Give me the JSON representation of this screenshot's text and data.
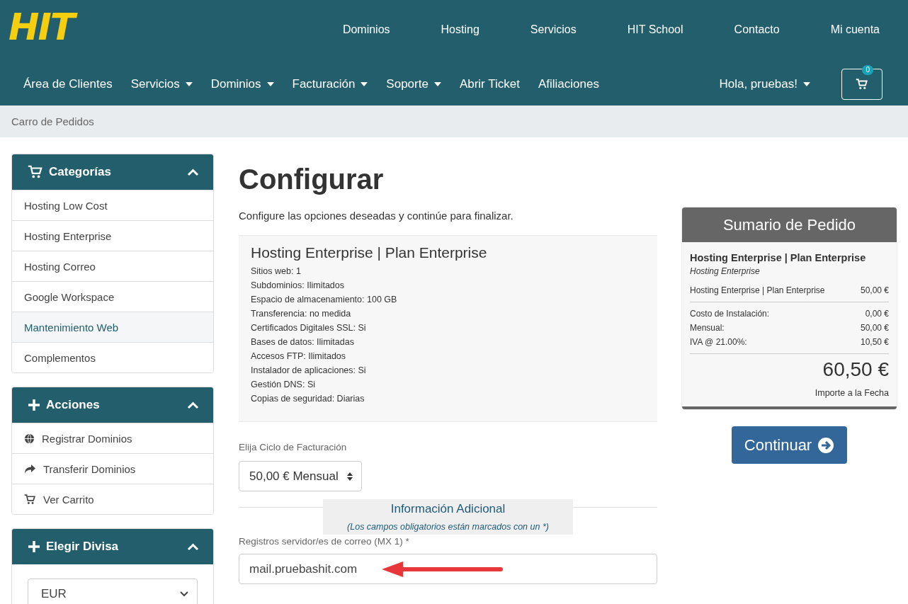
{
  "logo": "HIT",
  "top_nav": [
    "Dominios",
    "Hosting",
    "Servicios",
    "HIT School",
    "Contacto",
    "Mi cuenta"
  ],
  "main_nav": [
    {
      "label": "Área de Clientes",
      "dropdown": false
    },
    {
      "label": "Servicios",
      "dropdown": true
    },
    {
      "label": "Dominios",
      "dropdown": true
    },
    {
      "label": "Facturación",
      "dropdown": true
    },
    {
      "label": "Soporte",
      "dropdown": true
    },
    {
      "label": "Abrir Ticket",
      "dropdown": false
    },
    {
      "label": "Afiliaciones",
      "dropdown": false
    }
  ],
  "user_menu": "Hola, pruebas!",
  "cart": {
    "count": "0"
  },
  "breadcrumb": "Carro de Pedidos",
  "sidebar": [
    {
      "kind": "list",
      "title": "Categorías",
      "expanded": true,
      "items": [
        {
          "label": "Hosting Low Cost",
          "highlighted": false
        },
        {
          "label": "Hosting Enterprise",
          "highlighted": false
        },
        {
          "label": "Hosting Correo",
          "highlighted": false
        },
        {
          "label": "Google Workspace",
          "highlighted": false
        },
        {
          "label": "Mantenimiento Web",
          "highlighted": true
        },
        {
          "label": "Complementos",
          "highlighted": false
        }
      ]
    },
    {
      "kind": "actions",
      "title": "Acciones",
      "expanded": true,
      "items": [
        {
          "label": "Registrar Dominios"
        },
        {
          "label": "Transferir Dominios"
        },
        {
          "label": "Ver Carrito"
        }
      ]
    },
    {
      "kind": "select",
      "title": "Elegir Divisa",
      "expanded": true,
      "value": "EUR"
    }
  ],
  "page_title": "Configurar",
  "intro": "Configure las opciones deseadas y continúe para finalizar.",
  "product": {
    "title": "Hosting Enterprise | Plan Enterprise",
    "features": [
      "Sitios web: 1",
      "Subdominios: Ilimitados",
      "Espacio de almacenamiento: 100 GB",
      "Transferencia: no medida",
      "Certificados Digitales SSL: Si",
      "Bases de datos: Ilimitadas",
      "Accesos FTP: Ilimitados",
      "Instalador de aplicaciones: Si",
      "Gestión DNS: Si",
      "Copias de seguridad: Diarias"
    ]
  },
  "billing": {
    "label": "Elija Ciclo de Facturación",
    "value": "50,00 € Mensual"
  },
  "additional": {
    "title": "Información Adicional",
    "note": "(Los campos obligatorios están marcados con un *)"
  },
  "fields": [
    {
      "label": "Registros servidor/es de correo (MX 1) *",
      "value": "mail.pruebashit.com",
      "arrow": true
    }
  ],
  "summary": {
    "title": "Sumario de Pedido",
    "product_name": "Hosting Enterprise | Plan Enterprise",
    "product_group": "Hosting Enterprise",
    "lines": [
      {
        "label": "Hosting Enterprise | Plan Enterprise",
        "amount": "50,00 €"
      }
    ],
    "totals": [
      {
        "label": "Costo de Instalación:",
        "amount": "0,00 €"
      },
      {
        "label": "Mensual:",
        "amount": "50,00 €"
      },
      {
        "label": "IVA @ 21.00%:",
        "amount": "10,50 €"
      }
    ],
    "total": "60,50 €",
    "total_label": "Importe a la Fecha"
  },
  "continue_button": "Continuar"
}
